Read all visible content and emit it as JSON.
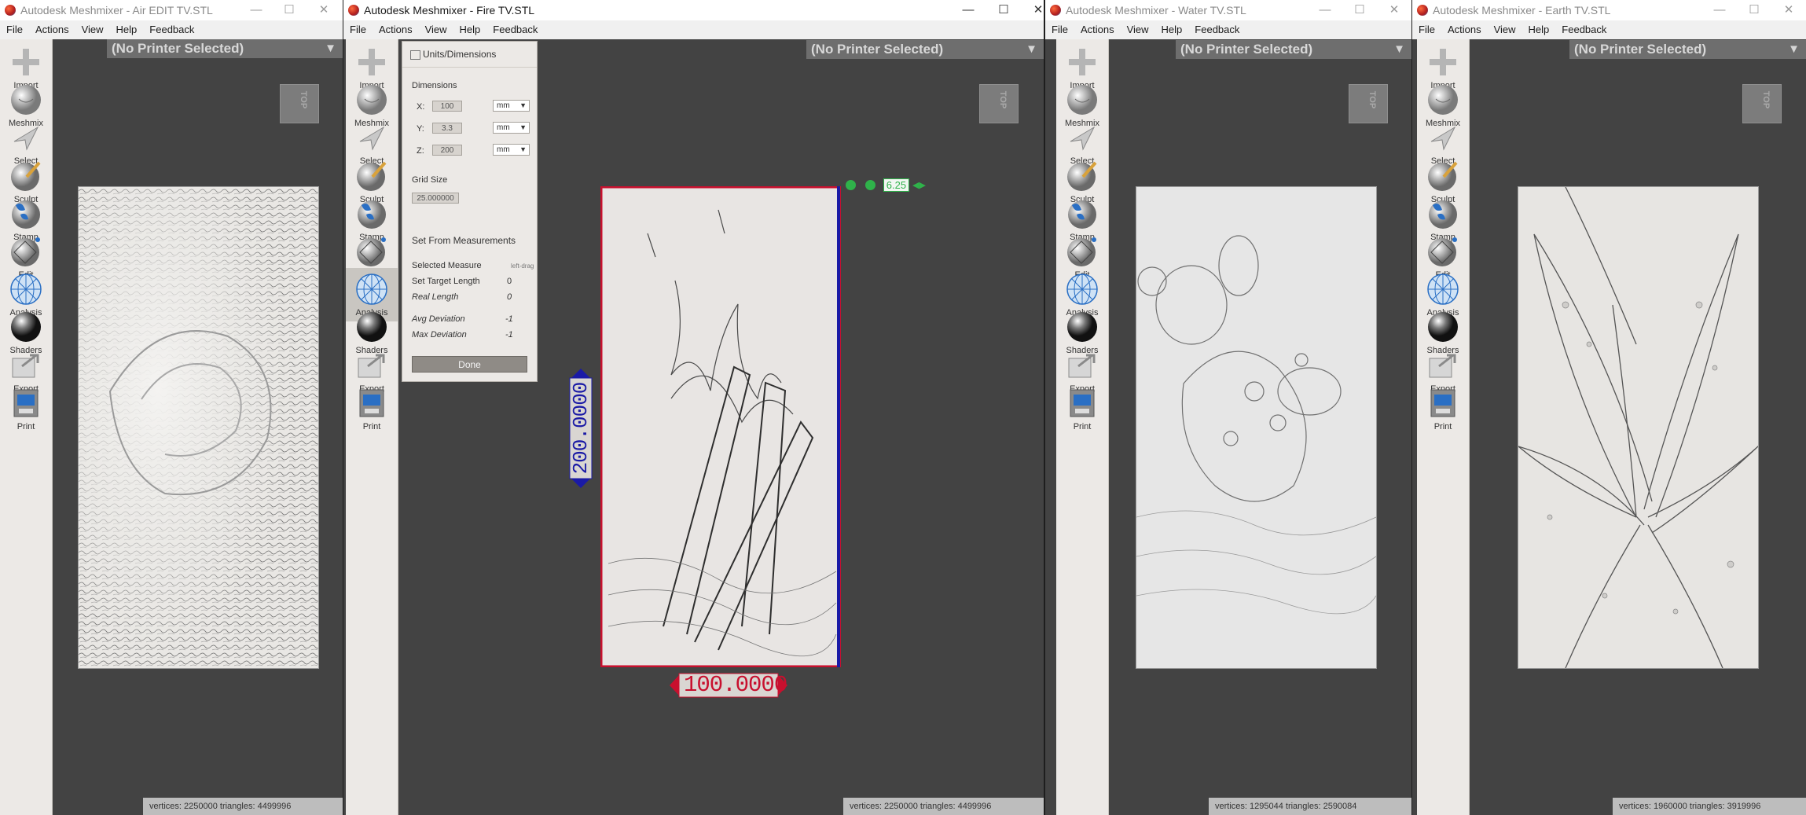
{
  "menu": [
    "File",
    "Actions",
    "View",
    "Help",
    "Feedback"
  ],
  "tools": [
    {
      "label": "Import",
      "icon": "plus-icon"
    },
    {
      "label": "Meshmix",
      "icon": "meshmix-sphere-icon"
    },
    {
      "label": "Select",
      "icon": "select-arrow-icon"
    },
    {
      "label": "Sculpt",
      "icon": "sculpt-brush-icon"
    },
    {
      "label": "Stamp",
      "icon": "stamp-icon"
    },
    {
      "label": "Edit",
      "icon": "edit-icon"
    },
    {
      "label": "Analysis",
      "icon": "analysis-globe-icon"
    },
    {
      "label": "Shaders",
      "icon": "shaders-sphere-icon"
    },
    {
      "label": "Export",
      "icon": "export-icon"
    },
    {
      "label": "Print",
      "icon": "print-icon"
    }
  ],
  "printer_label": "(No Printer Selected)",
  "view_cube_label": "TOP",
  "window_controls": {
    "minimize": "—",
    "maximize": "☐",
    "close": "✕"
  },
  "windows": [
    {
      "title": "Autodesk Meshmixer - Air EDIT TV.STL",
      "status": "vertices: 2250000 triangles: 4499996",
      "active": false
    },
    {
      "title": "Autodesk Meshmixer - Fire TV.STL",
      "status": "vertices: 2250000 triangles: 4499996",
      "active": true,
      "active_tool": "Analysis"
    },
    {
      "title": "Autodesk Meshmixer - Water TV.STL",
      "status": "vertices: 1295044 triangles: 2590084",
      "active": false
    },
    {
      "title": "Autodesk Meshmixer - Earth TV.STL",
      "status": "vertices: 1960000 triangles: 3919996",
      "active": false
    }
  ],
  "units_panel": {
    "title": "Units/Dimensions",
    "dimensions_label": "Dimensions",
    "x_label": "X:",
    "x_value": "100",
    "x_unit": "mm",
    "y_label": "Y:",
    "y_value": "3.3",
    "y_unit": "mm",
    "z_label": "Z:",
    "z_value": "200",
    "z_unit": "mm",
    "grid_size_label": "Grid Size",
    "grid_size_value": "25.000000",
    "set_from_label": "Set From Measurements",
    "selected_measure_label": "Selected Measure",
    "selected_measure_hint": "left-drag",
    "set_target_label": "Set Target Length",
    "set_target_value": "0",
    "real_length_label": "Real Length",
    "real_length_value": "0",
    "avg_dev_label": "Avg Deviation",
    "avg_dev_value": "-1",
    "max_dev_label": "Max Deviation",
    "max_dev_value": "-1",
    "done_label": "Done"
  },
  "dimension_x": "100.0000",
  "dimension_y": "200.0000",
  "thickness_readout": "6.25",
  "colors": {
    "bound_red": "#c8102e",
    "bound_blue": "#1a1aa6",
    "measure_green": "#2fb24a"
  }
}
